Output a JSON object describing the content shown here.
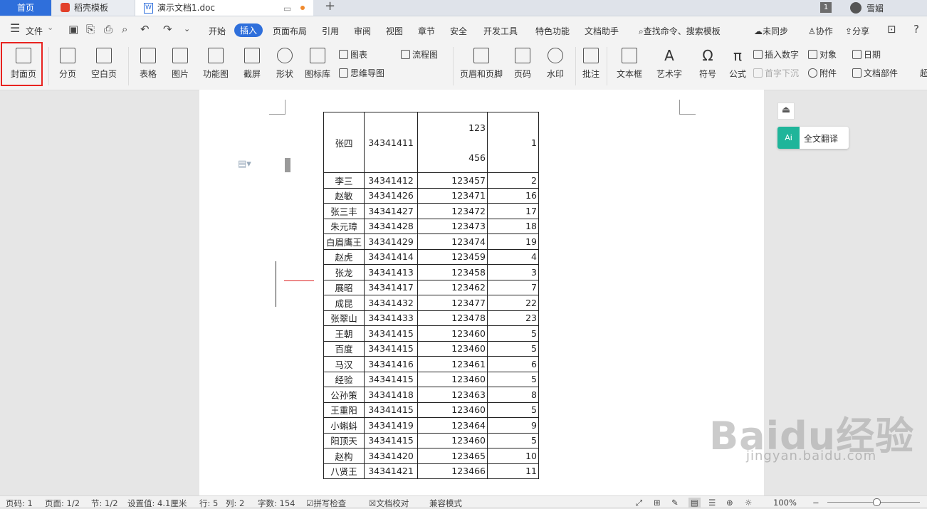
{
  "tabs": {
    "home": "首页",
    "template": "稻壳模板",
    "doc": "演示文档1.doc",
    "window_count": "1",
    "user": "雪媚"
  },
  "menu": {
    "file": "文件",
    "items": [
      "开始",
      "插入",
      "页面布局",
      "引用",
      "审阅",
      "视图",
      "章节",
      "安全",
      "开发工具",
      "特色功能",
      "文档助手"
    ],
    "active": "插入",
    "search": "查找命令、搜索模板",
    "sync": "未同步",
    "collab": "协作",
    "share": "分享"
  },
  "ribbon": {
    "cover": "封面页",
    "page_break": "分页",
    "blank_page": "空白页",
    "table": "表格",
    "picture": "图片",
    "func_chart": "功能图",
    "screenshot": "截屏",
    "shape": "形状",
    "icon_lib": "图标库",
    "chart": "图表",
    "mindmap": "思维导图",
    "flowchart": "流程图",
    "header_footer": "页眉和页脚",
    "page_num": "页码",
    "watermark": "水印",
    "comment": "批注",
    "textbox": "文本框",
    "wordart": "艺术字",
    "symbol": "符号",
    "formula": "公式",
    "insert_number": "插入数字",
    "drop_cap": "首字下沉",
    "object": "对象",
    "attachment": "附件",
    "date": "日期",
    "doc_parts": "文档部件",
    "more": "超"
  },
  "table": {
    "rows": [
      [
        "张四",
        "34341411",
        "123\n\n456",
        "1"
      ],
      [
        "李三",
        "34341412",
        "123457",
        "2"
      ],
      [
        "赵敏",
        "34341426",
        "123471",
        "16"
      ],
      [
        "张三丰",
        "34341427",
        "123472",
        "17"
      ],
      [
        "朱元璋",
        "34341428",
        "123473",
        "18"
      ],
      [
        "白眉鹰王",
        "34341429",
        "123474",
        "19"
      ],
      [
        "赵虎",
        "34341414",
        "123459",
        "4"
      ],
      [
        "张龙",
        "34341413",
        "123458",
        "3"
      ],
      [
        "展昭",
        "34341417",
        "123462",
        "7"
      ],
      [
        "成昆",
        "34341432",
        "123477",
        "22"
      ],
      [
        "张翠山",
        "34341433",
        "123478",
        "23"
      ],
      [
        "王朝",
        "34341415",
        "123460",
        "5"
      ],
      [
        "百度",
        "34341415",
        "123460",
        "5"
      ],
      [
        "马汉",
        "34341416",
        "123461",
        "6"
      ],
      [
        "经验",
        "34341415",
        "123460",
        "5"
      ],
      [
        "公孙策",
        "34341418",
        "123463",
        "8"
      ],
      [
        "王重阳",
        "34341415",
        "123460",
        "5"
      ],
      [
        "小蝌蚪",
        "34341419",
        "123464",
        "9"
      ],
      [
        "阳顶天",
        "34341415",
        "123460",
        "5"
      ],
      [
        "赵构",
        "34341420",
        "123465",
        "10"
      ],
      [
        "八贤王",
        "34341421",
        "123466",
        "11"
      ]
    ]
  },
  "side": {
    "translate": "全文翻译",
    "translate_icon": "Ai"
  },
  "status": {
    "page": "页码: 1",
    "pages": "页面: 1/2",
    "section": "节: 1/2",
    "setting": "设置值: 4.1厘米",
    "row": "行: 5",
    "col": "列: 2",
    "words": "字数: 154",
    "spell": "拼写检查",
    "proof": "文档校对",
    "compat": "兼容模式",
    "zoom": "100%"
  },
  "watermark": {
    "brand": "Baidu经验",
    "url": "jingyan.baidu.com"
  },
  "colors": {
    "accent": "#2f6fdb",
    "highlight": "#e8231f",
    "translate": "#1fb59a"
  }
}
